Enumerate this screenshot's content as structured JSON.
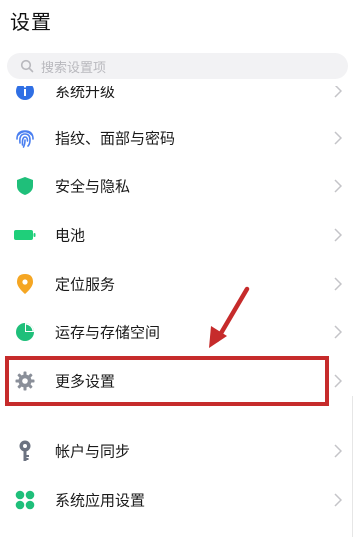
{
  "header": {
    "title": "设置"
  },
  "search": {
    "placeholder": "搜索设置项"
  },
  "items": [
    {
      "id": "system-upgrade",
      "label": "系统升级",
      "icon": "info-icon",
      "color": "#2f6fe4"
    },
    {
      "id": "fingerprint",
      "label": "指纹、面部与密码",
      "icon": "fingerprint-icon",
      "color": "#4a7ff0"
    },
    {
      "id": "security",
      "label": "安全与隐私",
      "icon": "shield-icon",
      "color": "#1fbf7a"
    },
    {
      "id": "battery",
      "label": "电池",
      "icon": "battery-icon",
      "color": "#1fcf7a"
    },
    {
      "id": "location",
      "label": "定位服务",
      "icon": "location-pin-icon",
      "color": "#f5a623"
    },
    {
      "id": "storage",
      "label": "运存与存储空间",
      "icon": "pie-chart-icon",
      "color": "#1fbf7a"
    },
    {
      "id": "more-settings",
      "label": "更多设置",
      "icon": "gear-icon",
      "color": "#8a8f99"
    },
    {
      "id": "accounts",
      "label": "帐户与同步",
      "icon": "key-icon",
      "color": "#6b7280"
    },
    {
      "id": "system-apps",
      "label": "系统应用设置",
      "icon": "apps-grid-icon",
      "color": "#1fbf7a"
    }
  ],
  "annotation": {
    "highlight_color": "#c62b2b",
    "highlighted_item": "more-settings"
  }
}
